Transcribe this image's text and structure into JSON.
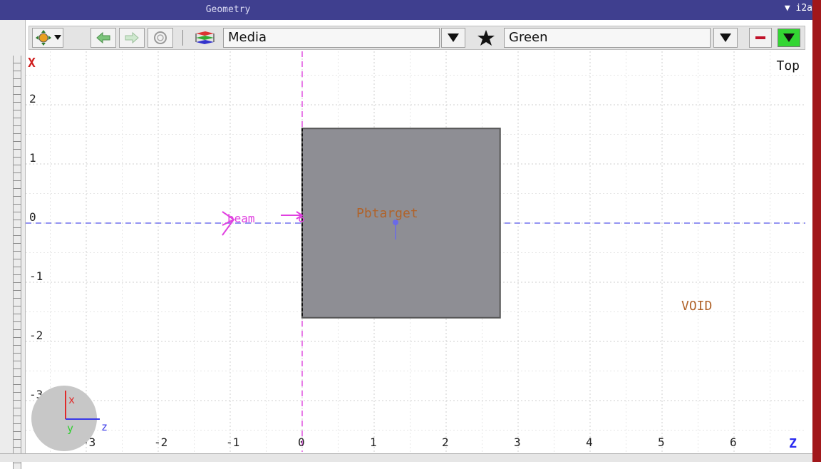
{
  "window": {
    "title": "Geometry",
    "corner_label": "▼ i2a"
  },
  "toolbar": {
    "icons": [
      "move-icon",
      "dropdown-arrow-icon",
      "back-arrow-icon",
      "forward-arrow-icon",
      "refresh-icon",
      "media-layers-icon",
      "star-icon",
      "minus-icon"
    ],
    "media_label": "Media",
    "color_value": "Green",
    "color_swatch": "#33d633"
  },
  "viewport": {
    "view_label": "Top",
    "vertical_axis_label": "X",
    "horizontal_axis_label": "Z",
    "x_ticks": [
      "-3",
      "-2",
      "-1",
      "0",
      "1",
      "2",
      "3",
      "4",
      "5",
      "6"
    ],
    "y_ticks": [
      "2",
      "1",
      "0",
      "-1",
      "-2",
      "-3"
    ],
    "region_labels": {
      "target": "Pbtarget",
      "void": "VOID",
      "beam": "beam"
    },
    "target_box": {
      "z_range": [
        0,
        2.75
      ],
      "x_range": [
        -1.6,
        1.6
      ],
      "fill": "#8e8e94"
    },
    "orientation_widget": {
      "x": "x",
      "y": "y",
      "z": "z"
    }
  }
}
